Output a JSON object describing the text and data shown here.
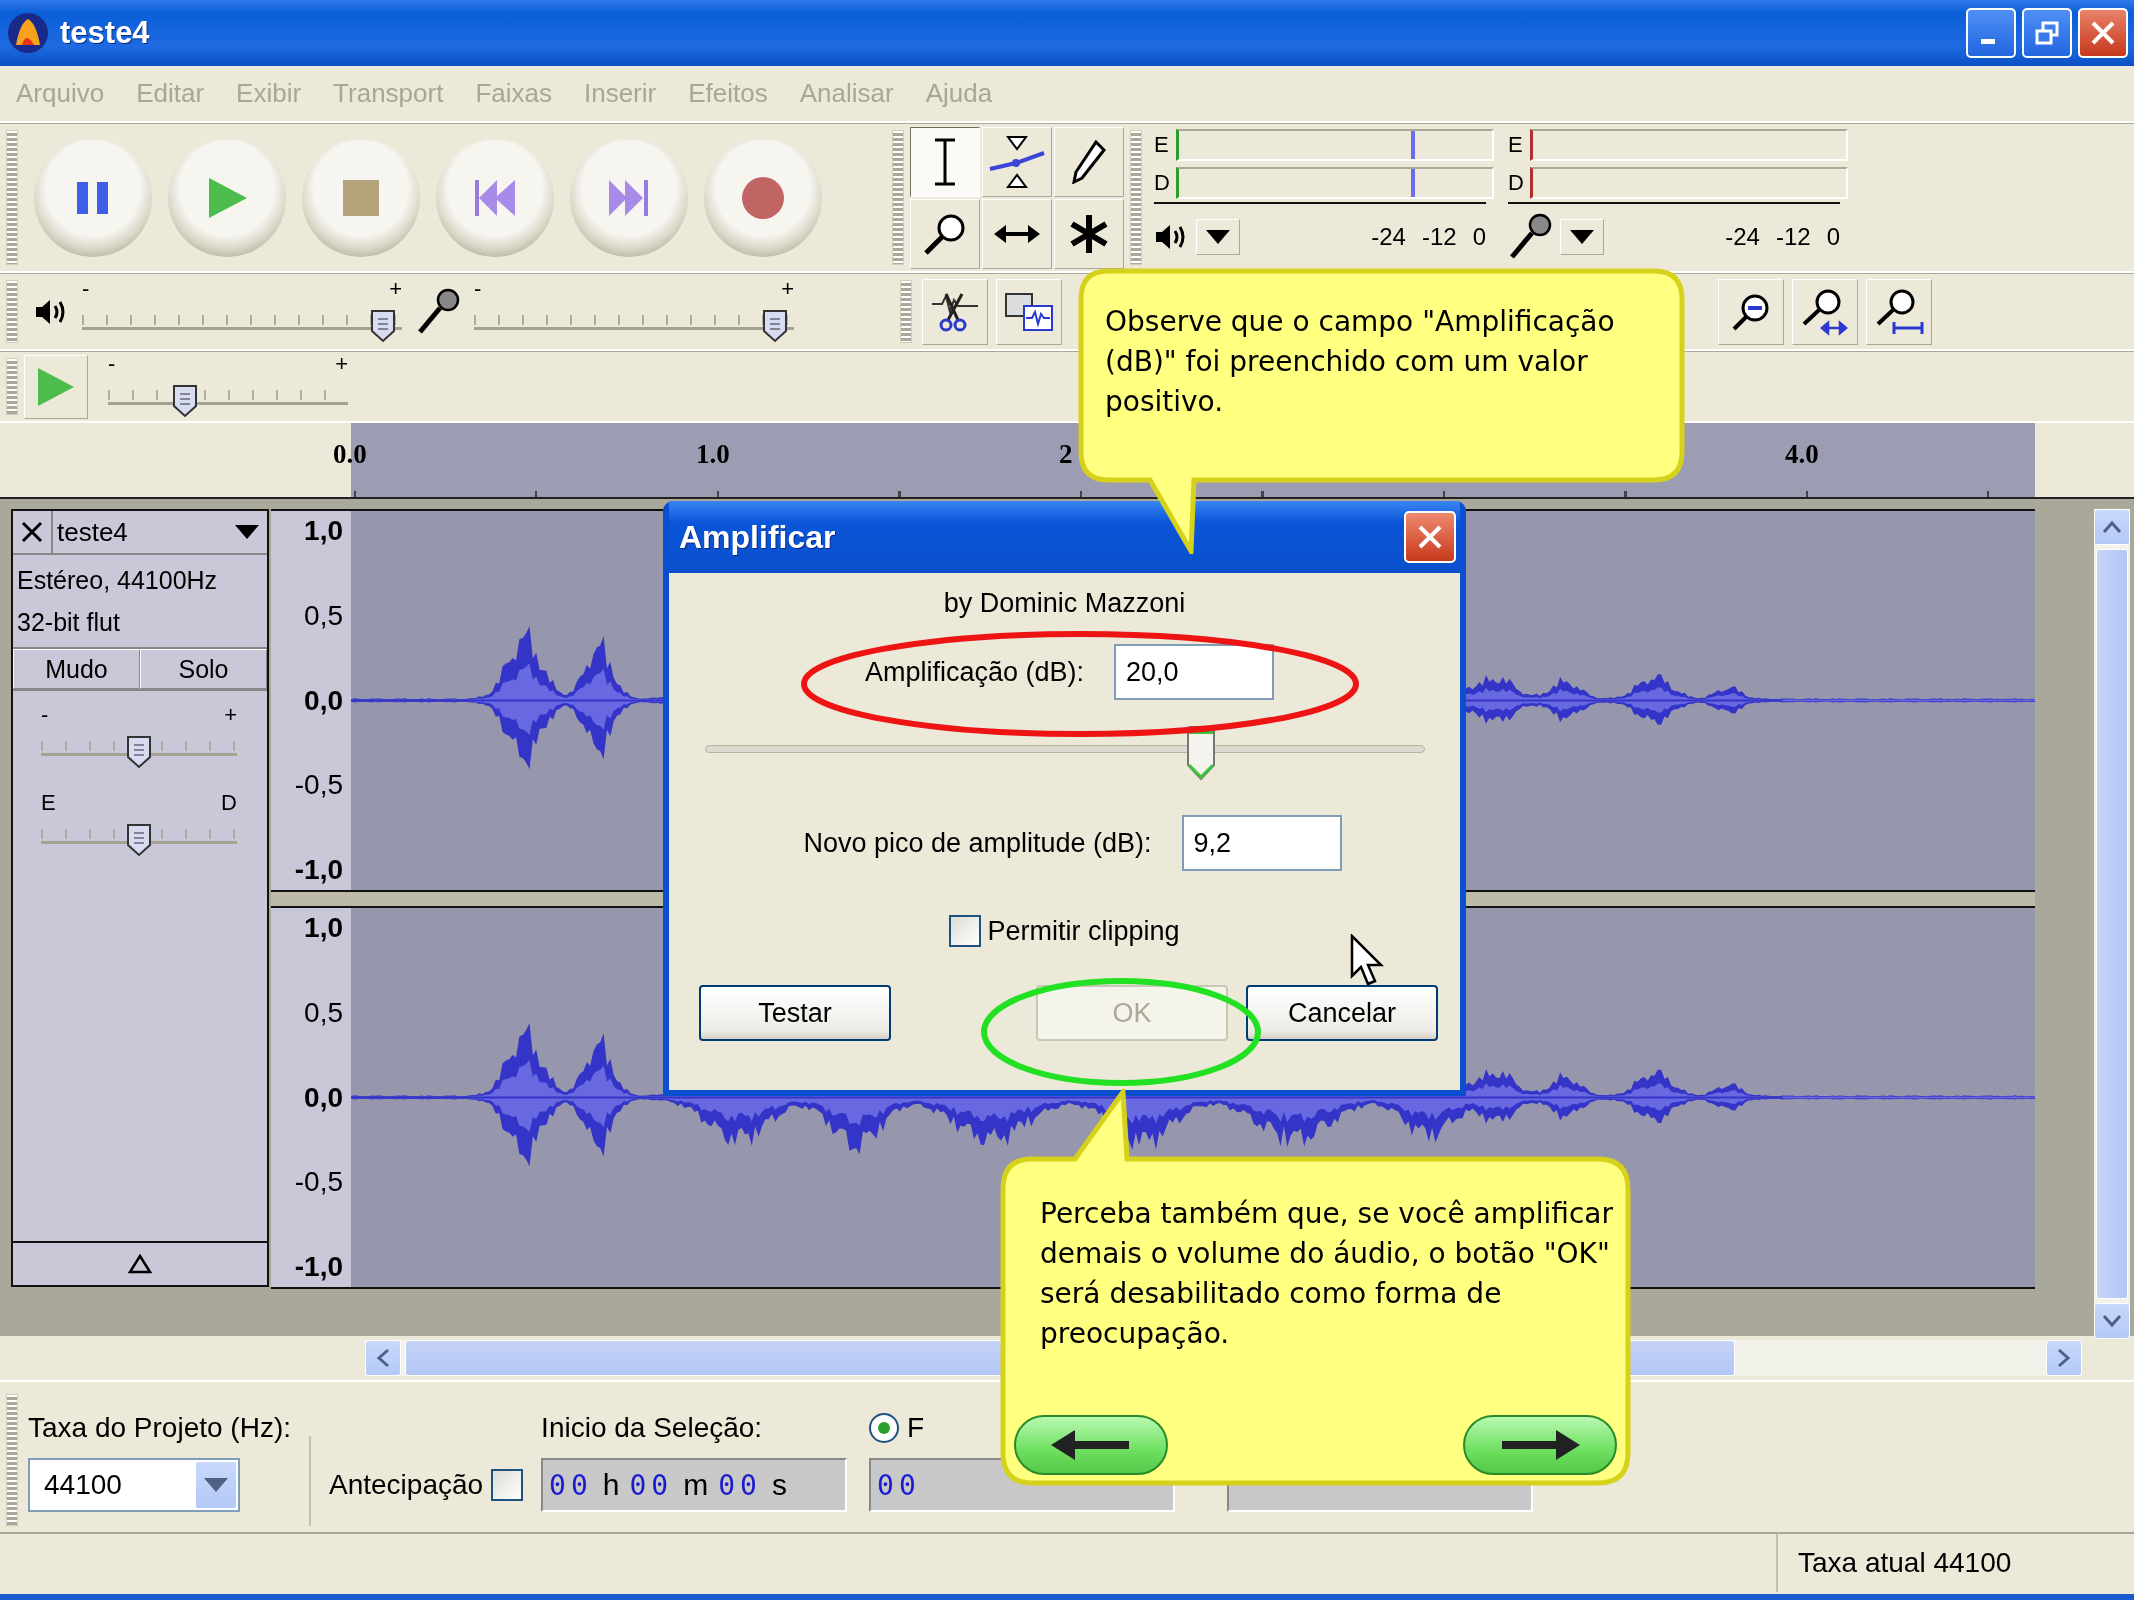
{
  "window": {
    "title": "teste4"
  },
  "menu": [
    {
      "label": "Arquivo",
      "disabled": true
    },
    {
      "label": "Editar",
      "disabled": true
    },
    {
      "label": "Exibir",
      "disabled": true
    },
    {
      "label": "Transport",
      "disabled": true
    },
    {
      "label": "Faixas",
      "disabled": true
    },
    {
      "label": "Inserir",
      "disabled": true
    },
    {
      "label": "Efeitos",
      "disabled": true
    },
    {
      "label": "Analisar",
      "disabled": true
    },
    {
      "label": "Ajuda",
      "disabled": true
    }
  ],
  "transport": [
    {
      "kind": "pause"
    },
    {
      "kind": "play"
    },
    {
      "kind": "stop"
    },
    {
      "kind": "skip_start"
    },
    {
      "kind": "skip_end"
    },
    {
      "kind": "record"
    }
  ],
  "tools": [
    {
      "kind": "select",
      "selected": true
    },
    {
      "kind": "envelope",
      "selected": false
    },
    {
      "kind": "draw",
      "selected": false
    },
    {
      "kind": "zoom",
      "selected": false
    },
    {
      "kind": "timeshift",
      "selected": false
    },
    {
      "kind": "multi",
      "selected": false
    }
  ],
  "meters": [
    {
      "kind": "playback",
      "channels": [
        "E",
        "D"
      ],
      "ticks": [
        "-24",
        "-12",
        "0"
      ]
    },
    {
      "kind": "record",
      "channels": [
        "E",
        "D"
      ],
      "ticks": [
        "-24",
        "-12",
        "0"
      ]
    }
  ],
  "mixer": {
    "output": {
      "minus": "-",
      "plus": "+",
      "level": 0.98
    },
    "input": {
      "minus": "-",
      "plus": "+",
      "level": 0.98
    }
  },
  "play_at_speed": {
    "minus": "-",
    "plus": "+",
    "level": 0.3
  },
  "ruler": {
    "ticks": [
      "0.0",
      "1.0",
      "2",
      "4.0"
    ]
  },
  "track": {
    "name": "teste4",
    "info": [
      "Estéreo, 44100Hz",
      "32-bit flut"
    ],
    "buttons": [
      {
        "label": "Mudo",
        "selected": false
      },
      {
        "label": "Solo",
        "selected": false
      }
    ],
    "gain": {
      "minus": "-",
      "plus": "+",
      "level": 0.5
    },
    "pan": {
      "left": "E",
      "right": "D",
      "level": 0.5
    },
    "channels": [
      {
        "ticks": [
          "1,0",
          "0,5",
          "0,0",
          "-0,5",
          "-1,0"
        ]
      },
      {
        "ticks": [
          "1,0",
          "0,5",
          "0,0",
          "-0,5",
          "-1,0"
        ]
      }
    ]
  },
  "dialog": {
    "title": "Amplificar",
    "author": "by Dominic Mazzoni",
    "amplification": {
      "label": "Amplificação (dB):",
      "value": "20,0"
    },
    "slider": {
      "level": 0.69
    },
    "new_peak": {
      "label": "Novo pico de amplitude (dB):",
      "value": "9,2"
    },
    "allow_clipping": {
      "label": "Permitir clipping",
      "checked": false
    },
    "buttons": [
      {
        "label": "Testar",
        "disabled": false
      },
      {
        "label": "OK",
        "disabled": true
      },
      {
        "label": "Cancelar",
        "disabled": false
      }
    ]
  },
  "callouts": [
    {
      "kind": "plain",
      "text": "Observe que o campo \"Amplificação (dB)\" foi preenchido com um valor positivo."
    },
    {
      "kind": "navigation",
      "text": "Perceba também que, se você amplificar demais o volume do áudio, o botão \"OK\" será desabilitado como forma de preocupação."
    }
  ],
  "selection_bar": {
    "rate_label": "Taxa do Projeto (Hz):",
    "rate_value": "44100",
    "snap": {
      "label": "Antecipação",
      "checked": false
    },
    "start_label": "Inicio da Seleção:",
    "radio": {
      "label": "F",
      "selected": true
    },
    "time_fields": [
      {
        "segments": [
          {
            "kind": "digits",
            "text": "00"
          },
          {
            "kind": "unit",
            "text": "h"
          },
          {
            "kind": "digits",
            "text": "00"
          },
          {
            "kind": "unit",
            "text": "m"
          },
          {
            "kind": "digits",
            "text": "00"
          },
          {
            "kind": "unit",
            "text": "s"
          }
        ]
      },
      {
        "segments": [
          {
            "kind": "digits",
            "text": "00"
          }
        ]
      }
    ]
  },
  "status_bar": {
    "text": "Taxa atual 44100"
  }
}
